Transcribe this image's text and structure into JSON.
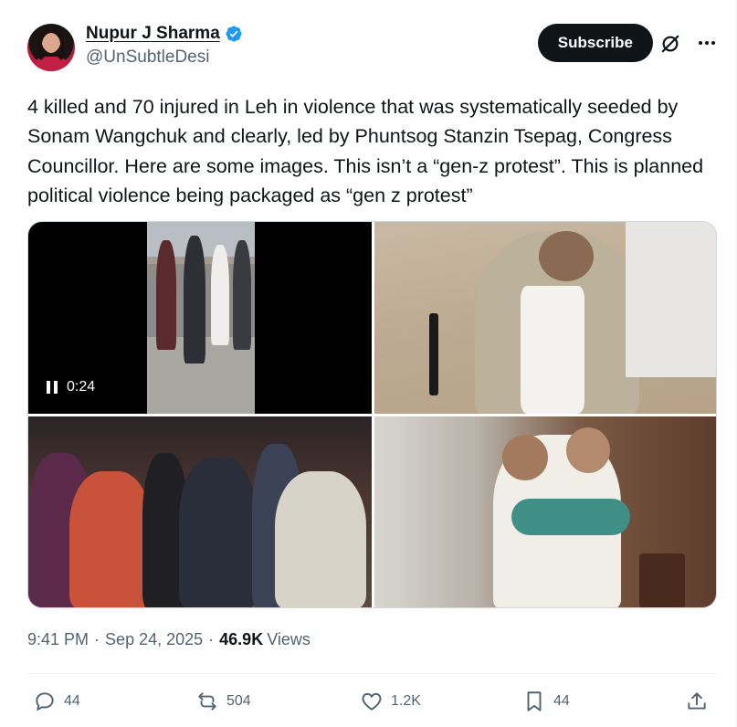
{
  "author": {
    "display_name": "Nupur J Sharma",
    "handle": "@UnSubtleDesi",
    "verified": true,
    "verified_color": "#1d9bf0"
  },
  "header": {
    "subscribe_label": "Subscribe",
    "grok_icon": "grok-icon",
    "more_icon": "more-options-icon"
  },
  "tweet": {
    "text": "4 killed and 70 injured in Leh in violence that was systematically seeded by Sonam Wangchuk and clearly, led by Phuntsog Stanzin Tsepag, Congress Councillor. Here are some images. This isn’t a “gen-z protest”. This is planned political violence being packaged as “gen z protest”"
  },
  "media": {
    "video_time": "0:24"
  },
  "meta": {
    "time": "9:41 PM",
    "date": "Sep 24, 2025",
    "views_count": "46.9K",
    "views_label": "Views"
  },
  "actions": {
    "replies": "44",
    "reposts": "504",
    "likes": "1.2K",
    "bookmarks": "44"
  },
  "colors": {
    "text_primary": "#0f1419",
    "text_secondary": "#536471",
    "button_bg": "#0f1419"
  }
}
